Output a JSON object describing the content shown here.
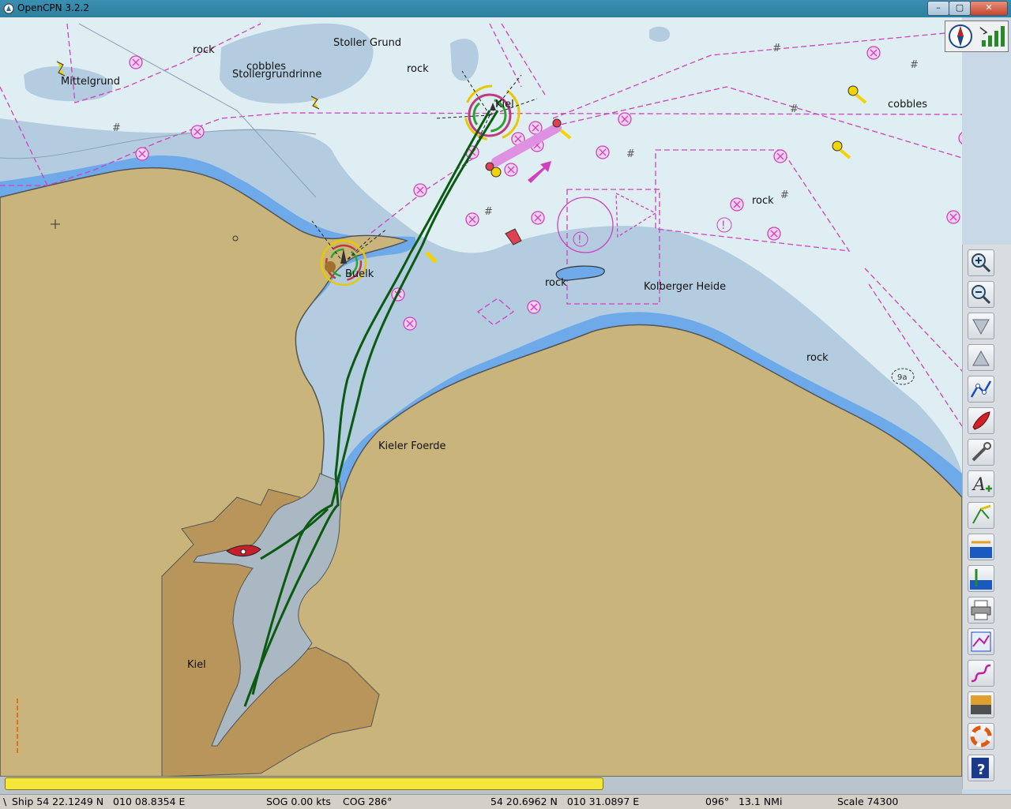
{
  "window": {
    "title": "OpenCPN 3.2.2",
    "controls": {
      "minimize": "–",
      "maximize": "▢",
      "close": "✕"
    }
  },
  "map": {
    "labels": {
      "stoller_grund": "Stoller Grund",
      "rock_top": "rock",
      "cobbles": "cobbles",
      "stollergrundrinne": "Stollergrundrinne",
      "rock_top2": "rock",
      "mittelgrund": "Mittelgrund",
      "kiel_light": "Kiel",
      "cobbles_right": "cobbles",
      "rock_right": "rock",
      "buelk": "Buelk",
      "rock_mid": "rock",
      "kolberger_heide": "Kolberger Heide",
      "rock_far_right": "rock",
      "kieler_foerde": "Kieler Foerde",
      "kiel_city": "Kiel",
      "sounding": "9a"
    },
    "colors": {
      "land": "#c9b57c",
      "urban": "#b8955a",
      "shallow": "#6eaaea",
      "medium": "#b4cce0",
      "deep": "#dfeef3",
      "harbor": "#a9b8c2",
      "track": "#0a5a12",
      "magenta": "#d040c0"
    }
  },
  "toolbar": {
    "items": [
      {
        "name": "zoom-in-icon"
      },
      {
        "name": "zoom-out-icon"
      },
      {
        "name": "scale-in-icon"
      },
      {
        "name": "scale-out-icon"
      },
      {
        "name": "route-icon"
      },
      {
        "name": "ship-follow-icon"
      },
      {
        "name": "settings-icon"
      },
      {
        "name": "text-icon"
      },
      {
        "name": "current-icon"
      },
      {
        "name": "tide-icon"
      },
      {
        "name": "depth-icon"
      },
      {
        "name": "print-icon"
      },
      {
        "name": "route-manager-icon"
      },
      {
        "name": "track-icon"
      },
      {
        "name": "color-scheme-icon"
      },
      {
        "name": "mob-icon"
      },
      {
        "name": "help-icon"
      }
    ]
  },
  "status": {
    "sep": "\\",
    "ship": "Ship 54 22.1249 N   010 08.8354 E",
    "sog": "SOG 0.00 kts",
    "cog": "COG 286°",
    "cursor": "54 20.6962 N   010 31.0897 E",
    "bearing": "096°   13.1 NMi",
    "scale": "Scale 74300"
  }
}
